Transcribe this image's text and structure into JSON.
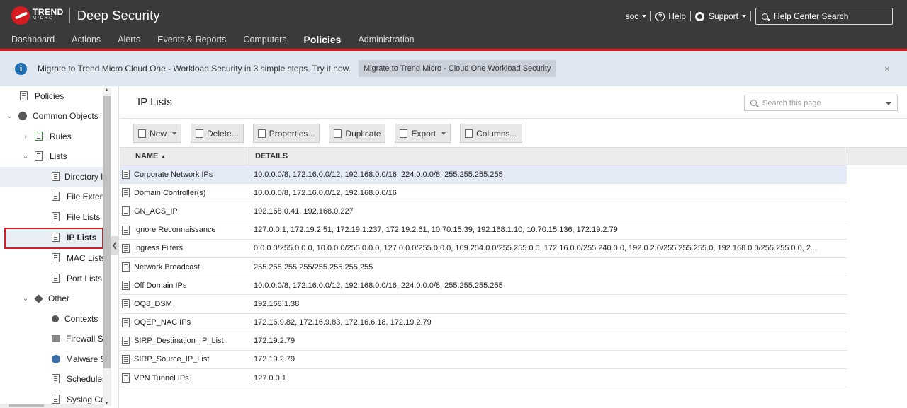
{
  "header": {
    "brand_line1": "TREND",
    "brand_line2": "MICRO",
    "product": "Deep Security",
    "user": "soc",
    "help": "Help",
    "support": "Support",
    "help_search_placeholder": "Help Center Search"
  },
  "nav": {
    "tabs": [
      "Dashboard",
      "Actions",
      "Alerts",
      "Events & Reports",
      "Computers",
      "Policies",
      "Administration"
    ],
    "active": "Policies"
  },
  "banner": {
    "text": "Migrate to Trend Micro Cloud One - Workload Security in 3 simple steps. Try it now.",
    "button": "Migrate to Trend Micro - Cloud One Workload Security",
    "close": "×"
  },
  "sidebar": {
    "items": [
      {
        "label": "Policies"
      },
      {
        "label": "Common Objects"
      },
      {
        "label": "Rules"
      },
      {
        "label": "Lists"
      },
      {
        "label": "Directory l"
      },
      {
        "label": "File Exten"
      },
      {
        "label": "File Lists"
      },
      {
        "label": "IP Lists"
      },
      {
        "label": "MAC Lists"
      },
      {
        "label": "Port Lists"
      },
      {
        "label": "Other"
      },
      {
        "label": "Contexts"
      },
      {
        "label": "Firewall S"
      },
      {
        "label": "Malware S"
      },
      {
        "label": "Schedules"
      },
      {
        "label": "Syslog Co"
      }
    ]
  },
  "main": {
    "title": "IP Lists",
    "search_placeholder": "Search this page",
    "toolbar": {
      "new": "New",
      "delete": "Delete...",
      "properties": "Properties...",
      "duplicate": "Duplicate",
      "export": "Export",
      "columns": "Columns..."
    },
    "columns": {
      "name": "NAME",
      "sort_indicator": "▲",
      "details": "DETAILS"
    },
    "rows": [
      {
        "name": "Corporate Network IPs",
        "details": "10.0.0.0/8, 172.16.0.0/12, 192.168.0.0/16, 224.0.0.0/8, 255.255.255.255"
      },
      {
        "name": "Domain Controller(s)",
        "details": "10.0.0.0/8, 172.16.0.0/12, 192.168.0.0/16"
      },
      {
        "name": "GN_ACS_IP",
        "details": "192.168.0.41, 192.168.0.227"
      },
      {
        "name": "Ignore Reconnaissance",
        "details": "127.0.0.1, 172.19.2.51, 172.19.1.237, 172.19.2.61, 10.70.15.39, 192.168.1.10, 10.70.15.136, 172.19.2.79"
      },
      {
        "name": "Ingress Filters",
        "details": "0.0.0.0/255.0.0.0, 10.0.0.0/255.0.0.0, 127.0.0.0/255.0.0.0, 169.254.0.0/255.255.0.0, 172.16.0.0/255.240.0.0, 192.0.2.0/255.255.255.0, 192.168.0.0/255.255.0.0, 2..."
      },
      {
        "name": "Network Broadcast",
        "details": "255.255.255.255/255.255.255.255"
      },
      {
        "name": "Off Domain IPs",
        "details": "10.0.0.0/8, 172.16.0.0/12, 192.168.0.0/16, 224.0.0.0/8, 255.255.255.255"
      },
      {
        "name": "OQ8_DSM",
        "details": "192.168.1.38"
      },
      {
        "name": "OQEP_NAC IPs",
        "details": "172.16.9.82, 172.16.9.83, 172.16.6.18, 172.19.2.79"
      },
      {
        "name": "SIRP_Destination_IP_List",
        "details": "172.19.2.79"
      },
      {
        "name": "SIRP_Source_IP_List",
        "details": "172.19.2.79"
      },
      {
        "name": "VPN Tunnel IPs",
        "details": "127.0.0.1"
      }
    ]
  },
  "colors": {
    "header_bg": "#3a3a3a",
    "accent_red": "#d71920",
    "banner_bg": "#dfe7f1",
    "selected_row": "#e4ebf6"
  }
}
